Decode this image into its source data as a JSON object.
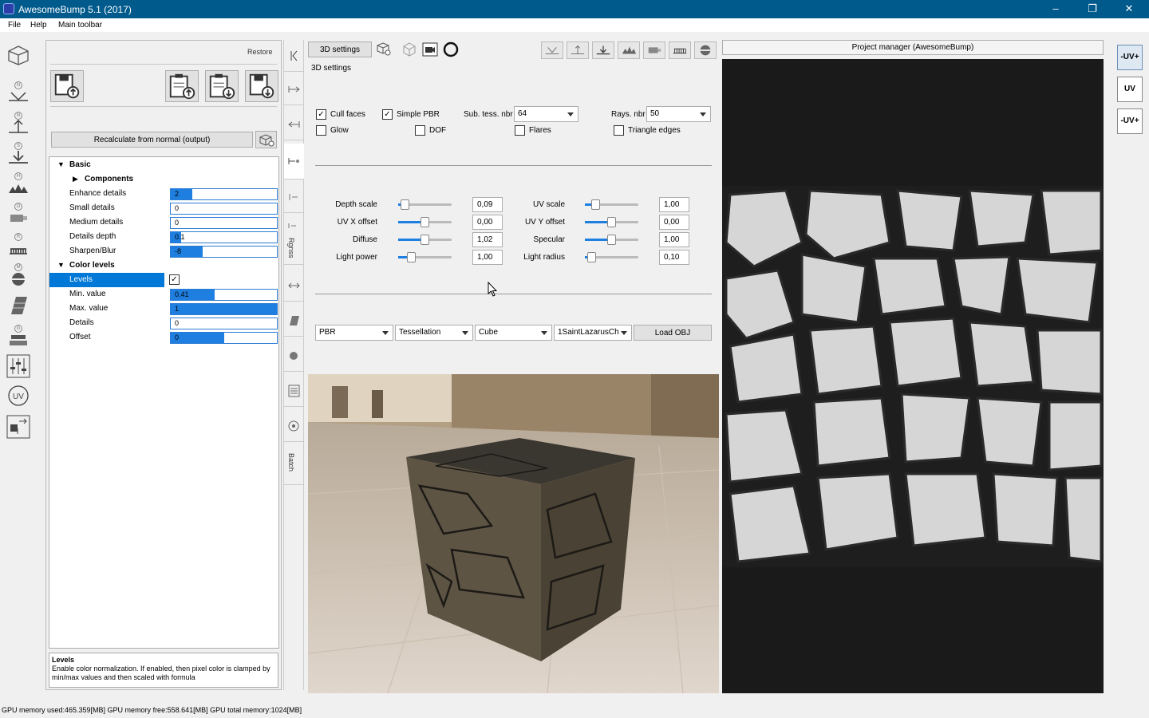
{
  "window": {
    "title": "AwesomeBump 5.1 (2017)",
    "minimize_icon": "minimize-icon",
    "maximize_icon": "restore-icon",
    "close_icon": "close-icon"
  },
  "menu": {
    "items": [
      "File",
      "Help",
      "Main toolbar"
    ]
  },
  "left_toolbar": {
    "icons": [
      "cube-icon",
      "normal-map-icon",
      "height-map-icon",
      "specular-icon",
      "occlusion-icon",
      "roughness-icon",
      "metallic-icon",
      "grunge-icon",
      "material-icon",
      "settings-sliders-icon",
      "uv-icon",
      "export-icon"
    ]
  },
  "panel": {
    "restore_label": "Restore",
    "recalc_label": "Recalculate from normal (output)",
    "tree": {
      "basic": "Basic",
      "components": "Components",
      "rows": [
        {
          "label": "Enhance details",
          "value": "2",
          "fill": 0.2
        },
        {
          "label": "Small details",
          "value": "0",
          "fill": 0
        },
        {
          "label": "Medium details",
          "value": "0",
          "fill": 0
        },
        {
          "label": "Details depth",
          "value": "0.1",
          "fill": 0.1
        },
        {
          "label": "Sharpen/Blur",
          "value": "-8",
          "fill": 0.3
        }
      ],
      "color_levels": "Color levels",
      "levels_label": "Levels",
      "levels_checked": "✓",
      "rows2": [
        {
          "label": "Min. value",
          "value": "0.41",
          "fill": 0.41
        },
        {
          "label": "Max. value",
          "value": "1",
          "fill": 1
        },
        {
          "label": "Details",
          "value": "0",
          "fill": 0
        },
        {
          "label": "Offset",
          "value": "0",
          "fill": 0.5
        }
      ]
    },
    "help_title": "Levels",
    "help_text": "Enable color normalization. If enabled, then pixel color is clamped by min/max values and then scaled with formula"
  },
  "vtabs": {
    "rgnss": "Rgnss",
    "batch": "Batch"
  },
  "settings3d": {
    "button": "3D settings",
    "section_label": "3D settings",
    "cull_faces": "Cull faces",
    "simple_pbr": "Simple PBR",
    "glow": "Glow",
    "dof": "DOF",
    "flares": "Flares",
    "triangle_edges": "Triangle edges",
    "check": "✓",
    "sub_tess_label": "Sub. tess. nbr",
    "sub_tess_value": "64",
    "rays_label": "Rays. nbr",
    "rays_value": "50",
    "sliders_left": [
      {
        "label": "Depth scale",
        "value": "0,09",
        "pos": 0.12
      },
      {
        "label": "UV X offset",
        "value": "0,00",
        "pos": 0.5
      },
      {
        "label": "Diffuse",
        "value": "1,02",
        "pos": 0.5
      },
      {
        "label": "Light power",
        "value": "1,00",
        "pos": 0.25
      }
    ],
    "sliders_right": [
      {
        "label": "UV scale",
        "value": "1,00",
        "pos": 0.2
      },
      {
        "label": "UV Y offset",
        "value": "0,00",
        "pos": 0.5
      },
      {
        "label": "Specular",
        "value": "1,00",
        "pos": 0.5
      },
      {
        "label": "Light radius",
        "value": "0,10",
        "pos": 0.1
      }
    ],
    "dropdowns": [
      "PBR",
      "Tessellation",
      "Cube",
      "1SaintLazarusCh"
    ],
    "load_obj": "Load OBJ"
  },
  "right_panel": {
    "project_manager": "Project manager (AwesomeBump)"
  },
  "uv_buttons": [
    "-UV+",
    "UV",
    "-UV+"
  ],
  "status": "GPU memory used:465.359[MB] GPU memory free:558.641[MB] GPU total memory:1024[MB]"
}
